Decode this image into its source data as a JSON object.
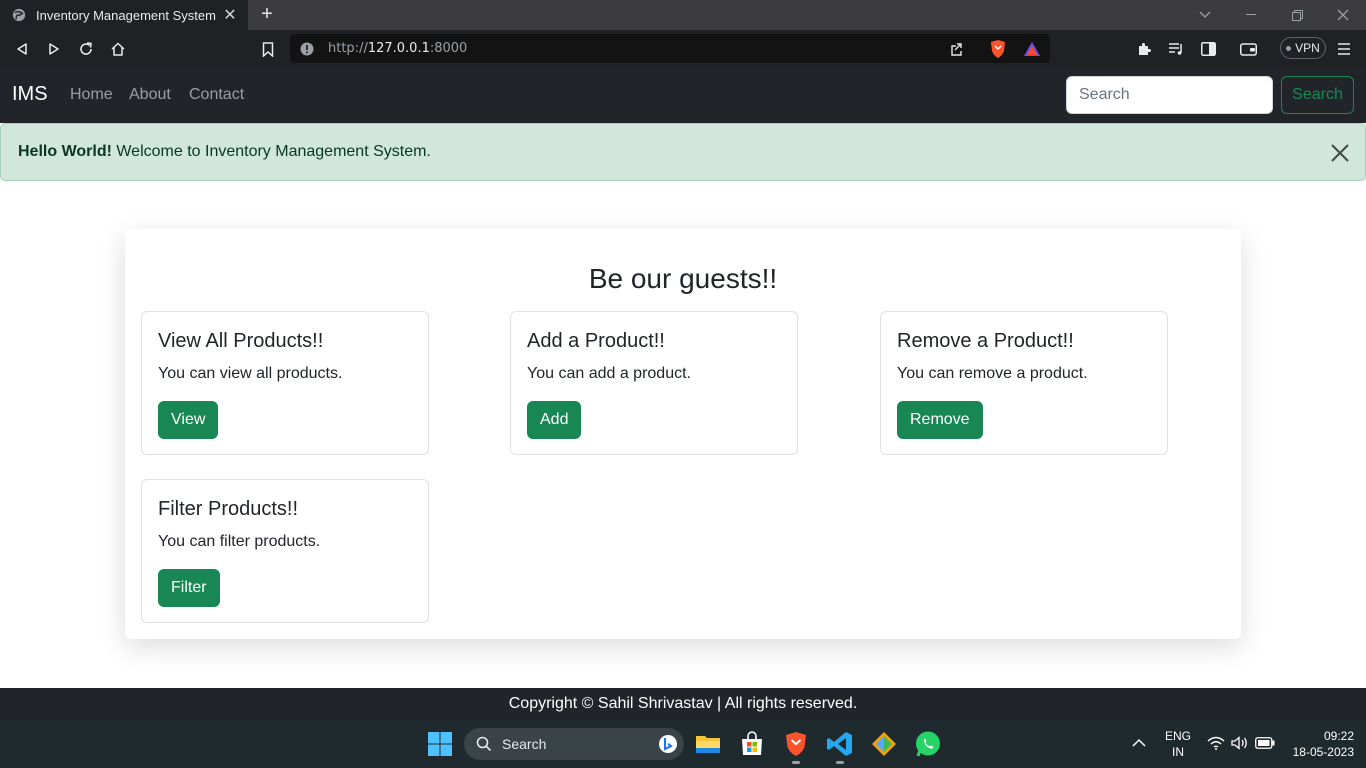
{
  "browser": {
    "tab_title": "Inventory Management System",
    "url_prefix": "http://",
    "url_host": "127.0.0.1",
    "url_port": ":8000",
    "vpn_label": "VPN"
  },
  "navbar": {
    "brand": "IMS",
    "links": [
      "Home",
      "About",
      "Contact"
    ],
    "search_placeholder": "Search",
    "search_button": "Search"
  },
  "alert": {
    "strong": "Hello World!",
    "text": " Welcome to Inventory Management System."
  },
  "main": {
    "heading": "Be our guests!!",
    "cards": [
      {
        "title": "View All Products!!",
        "text": "You can view all products.",
        "button": "View"
      },
      {
        "title": "Add a Product!!",
        "text": "You can add a product.",
        "button": "Add"
      },
      {
        "title": "Remove a Product!!",
        "text": "You can remove a product.",
        "button": "Remove"
      },
      {
        "title": "Filter Products!!",
        "text": "You can filter products.",
        "button": "Filter"
      }
    ]
  },
  "footer": {
    "text": "Copyright © Sahil Shrivastav | All rights reserved."
  },
  "taskbar": {
    "search_label": "Search",
    "lang_top": "ENG",
    "lang_bottom": "IN",
    "time": "09:22",
    "date": "18-05-2023"
  },
  "colors": {
    "success": "#198754",
    "navbar_bg": "#212529",
    "alert_bg": "#d1e7dd"
  }
}
